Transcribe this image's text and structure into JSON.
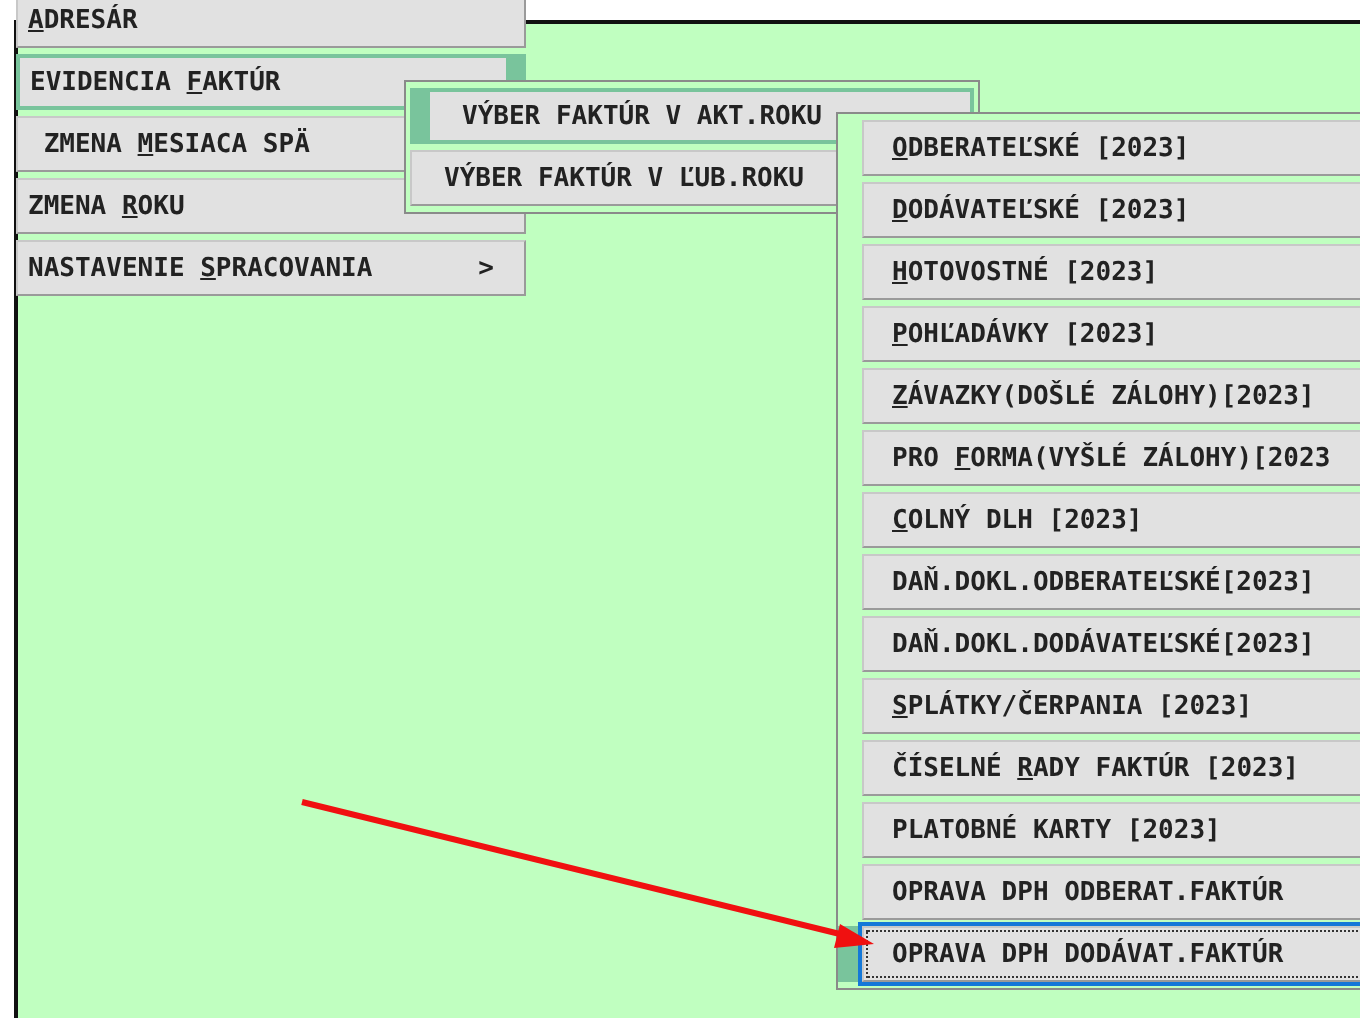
{
  "main_menu": {
    "items": [
      {
        "key": "A",
        "post": "DRESÁR",
        "selected": false
      },
      {
        "pre": "EVIDENCIA ",
        "key": "F",
        "post": "AKTÚR",
        "selected": true
      },
      {
        "pre": " ZMENA ",
        "key": "M",
        "post": "ESIACA SPÄ",
        "selected": false
      },
      {
        "pre": "ZMENA ",
        "key": "R",
        "post": "OKU",
        "selected": false
      },
      {
        "pre": "NASTAVENIE ",
        "key": "S",
        "post": "PRACOVANIA",
        "selected": false,
        "arrow": ">"
      }
    ]
  },
  "submenu": {
    "items": [
      {
        "pre": "VÝBER FAKTÚR V AKT.ROKU",
        "selected": true
      },
      {
        "pre": "VÝBER FAKTÚR V ĽUB.ROKU",
        "selected": false
      }
    ]
  },
  "invoice_menu": {
    "items": [
      {
        "key": "O",
        "post": "DBERATEĽSKÉ [2023]",
        "selected": false
      },
      {
        "key": "D",
        "post": "ODÁVATEĽSKÉ [2023]",
        "selected": false
      },
      {
        "key": "H",
        "post": "OTOVOSTNÉ [2023]",
        "selected": false
      },
      {
        "key": "P",
        "post": "OHĽADÁVKY [2023]",
        "selected": false
      },
      {
        "key": "Z",
        "post": "ÁVAZKY(DOŠLÉ ZÁLOHY)[2023]",
        "selected": false
      },
      {
        "pre": "PRO ",
        "key": "F",
        "post": "ORMA(VYŠLÉ ZÁLOHY)[2023",
        "selected": false
      },
      {
        "key": "C",
        "post": "OLNÝ DLH [2023]",
        "selected": false
      },
      {
        "pre": "DAŇ.DOKL.ODBERATEĽSKÉ[2023]",
        "selected": false
      },
      {
        "pre": "DAŇ.DOKL.DODÁVATEĽSKÉ[2023]",
        "selected": false
      },
      {
        "key": "S",
        "post": "PLÁTKY/ČERPANIA [2023]",
        "selected": false
      },
      {
        "pre": "ČÍSELNÉ ",
        "key": "R",
        "post": "ADY FAKTÚR [2023]",
        "selected": false
      },
      {
        "pre": "PLATOBNÉ KARTY [2023]",
        "selected": false
      },
      {
        "pre": "OPRAVA DPH ODBERAT.FAKTÚR",
        "selected": false
      },
      {
        "pre": "OPRAVA DPH DODÁVAT.FAKTÚR",
        "selected": true
      }
    ]
  }
}
